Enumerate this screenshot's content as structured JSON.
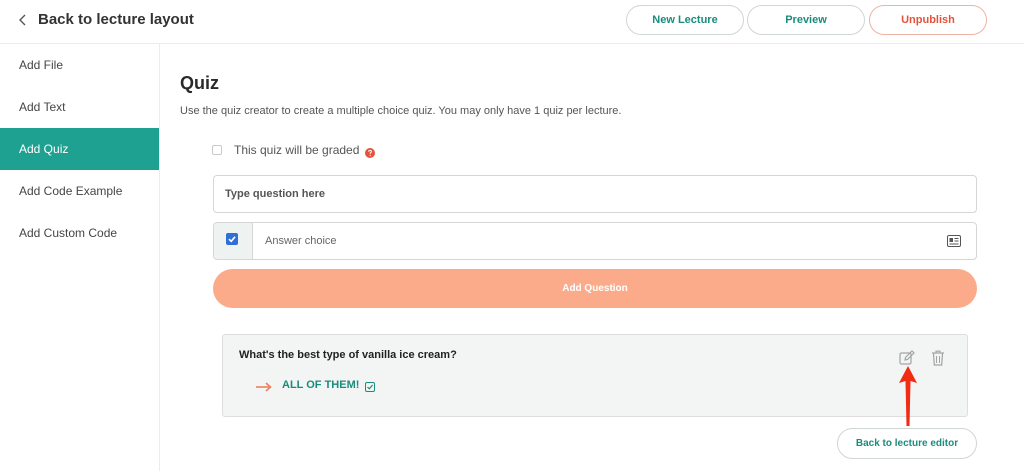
{
  "header": {
    "back_label": "Back to lecture layout",
    "buttons": {
      "new_lecture": "New Lecture",
      "preview": "Preview",
      "unpublish": "Unpublish"
    }
  },
  "sidebar": {
    "items": [
      {
        "label": "Add File",
        "active": false
      },
      {
        "label": "Add Text",
        "active": false
      },
      {
        "label": "Add Quiz",
        "active": true
      },
      {
        "label": "Add Code Example",
        "active": false
      },
      {
        "label": "Add Custom Code",
        "active": false
      }
    ]
  },
  "quiz": {
    "title": "Quiz",
    "description": "Use the quiz creator to create a multiple choice quiz. You may only have 1 quiz per lecture.",
    "graded_label": "This quiz will be graded",
    "graded_checked": false,
    "question_placeholder": "Type question here",
    "question_value": "",
    "answer_placeholder": "Answer choice",
    "answer_value": "",
    "answer_checked": true,
    "add_question_label": "Add Question"
  },
  "question_card": {
    "question": "What's the best type of vanilla ice cream?",
    "answer": "ALL OF THEM!",
    "answer_correct": true
  },
  "footer": {
    "back_to_editor": "Back to lecture editor"
  },
  "colors": {
    "teal": "#1fa191",
    "teal_text": "#1a8c7c",
    "orange": "#fbab8a",
    "red": "#e4533b",
    "annotation_arrow": "#f22b13"
  },
  "icons": {
    "back": "chevron-left-icon",
    "help": "question-circle-icon",
    "answer_field": "id-card-icon",
    "answer_bullet": "arrow-right-icon",
    "correct": "check-square-icon",
    "edit": "edit-icon",
    "delete": "trash-icon"
  }
}
